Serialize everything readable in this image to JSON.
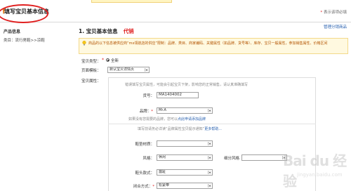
{
  "header": {
    "title": "填写宝贝基本信息",
    "required_note_star": "*",
    "required_note": "表示该项必填"
  },
  "sidebar": {
    "title": "产品信息",
    "category_path": "类目：流行男鞋>>凉鞋"
  },
  "main": {
    "manage_link": "管理分销商品",
    "section_title": "1. 宝贝基本信息",
    "section_badge": "代销",
    "notice": "商品的以下信息被供应商“mx领航店的供应”限制：品牌、类目、商家编码、关键属性（如品牌、货号等）、库存、宝贝一般属性，参加销售属性、价格区间",
    "type_label": "宝贝类型：",
    "type_star": "*",
    "type_value": "全新",
    "page_template_label": "页面模板：",
    "page_template_value": "默认宝贝详情页",
    "attr_label": "宝贝属性："
  },
  "attributes": {
    "hint_top": "错误填写宝贝属性，可能会引起宝贝下架，影响您的正常销售，请认真准确填写",
    "item_no_label": "货号：",
    "item_no_value": "MA1404002",
    "brand_label": "品牌：",
    "brand_star": "*",
    "brand_value": "Mr.A",
    "brand_hint_prefix": "如果没有您需要的品牌，您可以",
    "brand_hint_link": "点此申请添加品牌",
    "note_prefix": "填写前请务必详读“品牌属性宝贝提示通知”",
    "note_link": "更多帮助...",
    "heel_label": "鞋垫材质：",
    "heel_value": "",
    "style_label": "风格：",
    "style_value": "休闲",
    "sub_style_label": "细分风格",
    "sub_style_value": "",
    "toe_label": "鞋头款式：",
    "toe_value": "露趾",
    "closure_label": "闭合方式：",
    "closure_star": "*",
    "closure_value": "松紧带"
  },
  "watermark": {
    "text": "Bai du 经验",
    "sub": "jingyan.baidu.com"
  }
}
